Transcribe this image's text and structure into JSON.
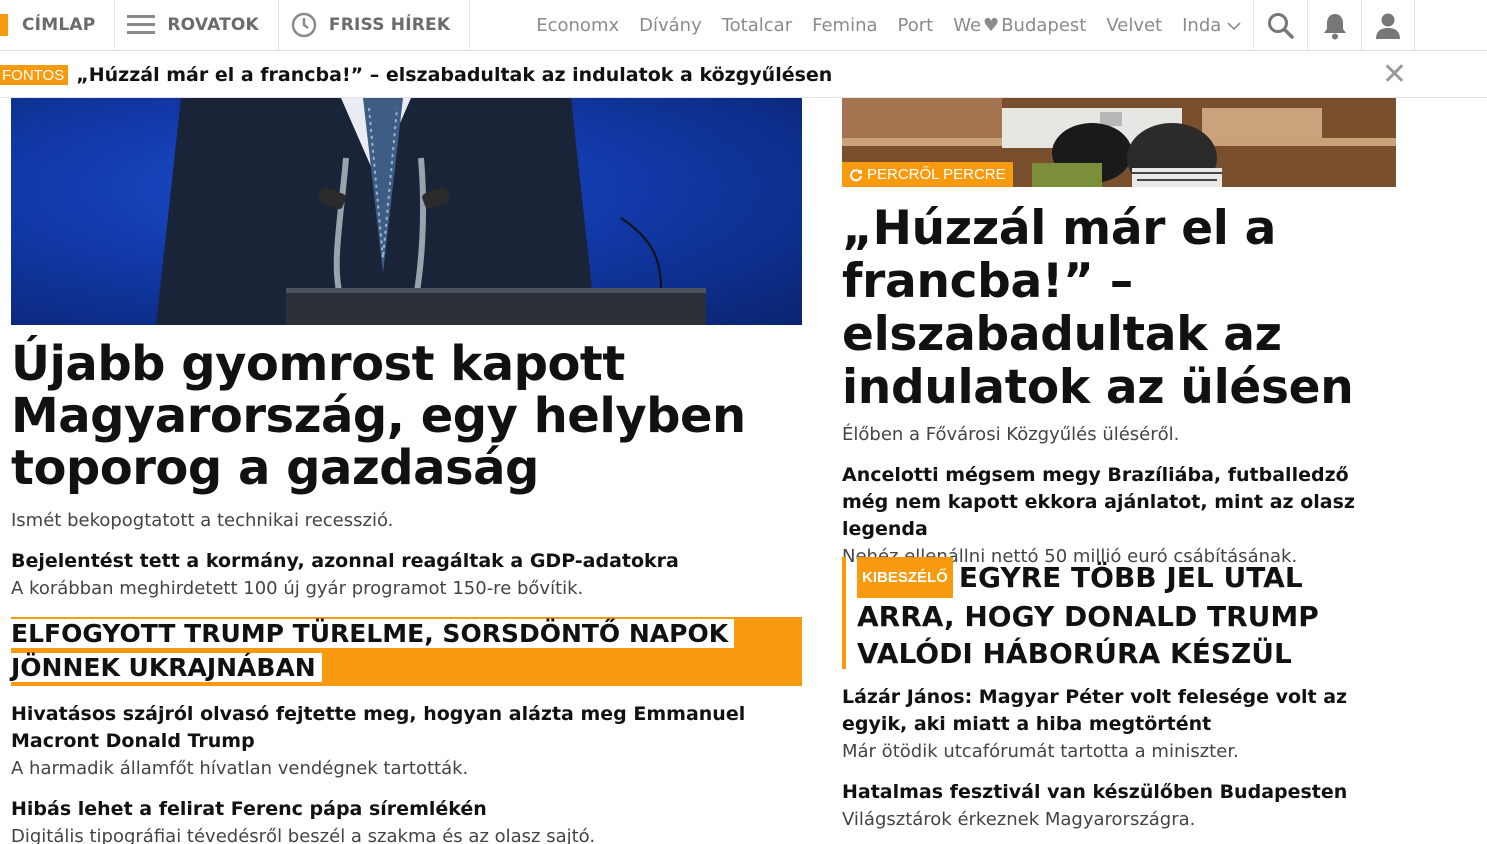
{
  "nav": {
    "cimlap": "CÍMLAP",
    "rovatok": "ROVATOK",
    "friss": "FRISS HÍREK",
    "links": [
      "Economx",
      "Dívány",
      "Totalcar",
      "Femina",
      "Port"
    ],
    "we_love_pre": "We",
    "we_love_post": "Budapest",
    "links2": [
      "Velvet",
      "Inda"
    ]
  },
  "breaking": {
    "badge": "FONTOS",
    "title": "„Húzzál már el a francba!” – elszabadultak az indulatok a közgyűlésen"
  },
  "left": {
    "hero_title": "Újabb gyomrost kapott Magyarország, egy helyben toporog a gazdaság",
    "hero_lead": "Ismét bekopogtatott a technikai recesszió.",
    "item1_title": "Bejelentést tett a kormány, azonnal reagáltak a GDP-adatokra",
    "item1_sub": "A korábban meghirdetett 100 új gyár programot 150-re bővítik.",
    "feature_line1": "Elfogyott Trump türelme, sorsdöntő napok",
    "feature_line2": "jönnek Ukrajnában",
    "item2_title": "Hivatásos szájról olvasó fejtette meg, hogyan alázta meg Emmanuel Macront Donald Trump",
    "item2_sub": "A harmadik államfőt hívatlan vendégnek tartották.",
    "item3_title": "Hibás lehet a felirat Ferenc pápa síremlékén",
    "item3_sub": "Digitális tipográfiai tévedésről beszél a szakma és az olasz sajtó."
  },
  "right": {
    "badge": "PERCRŐL PERCRE",
    "title": "„Húzzál már el a francba!” – elszabadultak az indulatok az ülésen",
    "lead": "Élőben a Fővárosi Közgyűlés üléséről.",
    "item1_title": "Ancelotti mégsem megy Brazíliába, futballedző még nem kapott ekkora ajánlatot, mint az olasz legenda",
    "item1_sub": "Nehéz ellenállni nettó 50 millió euró csábításának.",
    "kibe_badge": "KIBESZÉLŐ",
    "kibe_title": "Egyre több jel utal arra, hogy Donald Trump valódi háborúra készül",
    "item2_title": "Lázár János: Magyar Péter volt felesége volt az egyik, aki miatt a hiba megtörtént",
    "item2_sub": "Már ötödik utcafórumát tartotta a miniszter.",
    "item3_title": "Hatalmas fesztivál van készülőben Budapesten",
    "item3_sub": "Világsztárok érkeznek Magyarországra."
  },
  "colors": {
    "accent": "#f89a0e",
    "text": "#111111",
    "muted": "#444444"
  }
}
